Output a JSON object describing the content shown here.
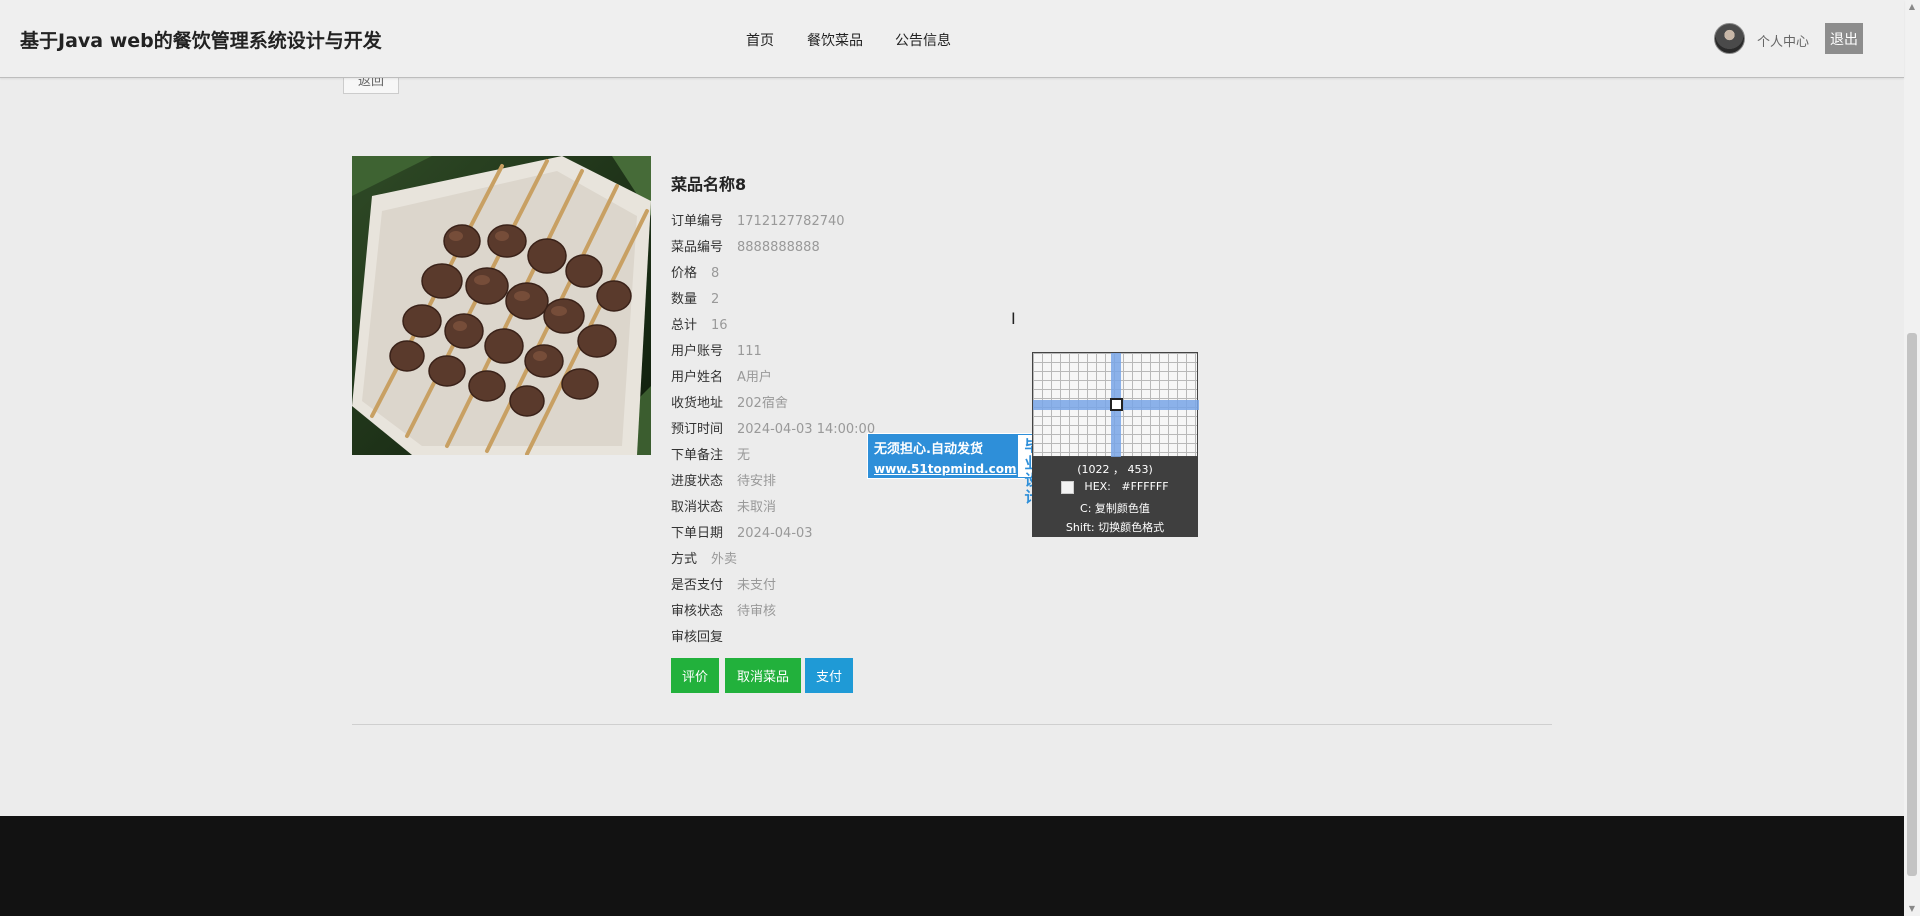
{
  "header": {
    "site_title": "基于Java web的餐饮管理系统设计与开发",
    "nav": [
      "首页",
      "餐饮菜品",
      "公告信息"
    ],
    "personal_center": "个人中心",
    "logout": "退出"
  },
  "back_button": "返回",
  "detail": {
    "title": "菜品名称8",
    "fields": [
      {
        "label": "订单编号",
        "value": "1712127782740"
      },
      {
        "label": "菜品编号",
        "value": "8888888888"
      },
      {
        "label": "价格",
        "value": "8"
      },
      {
        "label": "数量",
        "value": "2"
      },
      {
        "label": "总计",
        "value": "16"
      },
      {
        "label": "用户账号",
        "value": "111"
      },
      {
        "label": "用户姓名",
        "value": "A用户"
      },
      {
        "label": "收货地址",
        "value": "202宿舍"
      },
      {
        "label": "预订时间",
        "value": "2024-04-03 14:00:00"
      },
      {
        "label": "下单备注",
        "value": "无"
      },
      {
        "label": "进度状态",
        "value": "待安排"
      },
      {
        "label": "取消状态",
        "value": "未取消"
      },
      {
        "label": "下单日期",
        "value": "2024-04-03"
      },
      {
        "label": "方式",
        "value": "外卖"
      },
      {
        "label": "是否支付",
        "value": "未支付"
      },
      {
        "label": "审核状态",
        "value": "待审核"
      },
      {
        "label": "审核回复",
        "value": ""
      }
    ],
    "actions": [
      "评价",
      "取消菜品",
      "支付"
    ]
  },
  "watermark": {
    "line1": "无须担心.自动发货",
    "line2": "www.51topmind.com",
    "badge_top": "毕业",
    "badge_bottom": "设计"
  },
  "color_picker": {
    "coords": "(1022 ， 453)",
    "hex_label": "HEX:",
    "hex_value": "#FFFFFF",
    "hint_copy": "C: 复制颜色值",
    "hint_switch": "Shift: 切换颜色格式"
  },
  "colors": {
    "header_bg": "#efefef",
    "page_bg": "#ececec",
    "action_green": "#22b13c",
    "action_blue": "#1f9ad6",
    "footer_bg": "#121212",
    "logout_bg": "#8d8d8d"
  },
  "icons": {
    "avatar": "avatar-icon",
    "cursor": "ibeam-cursor-icon"
  }
}
